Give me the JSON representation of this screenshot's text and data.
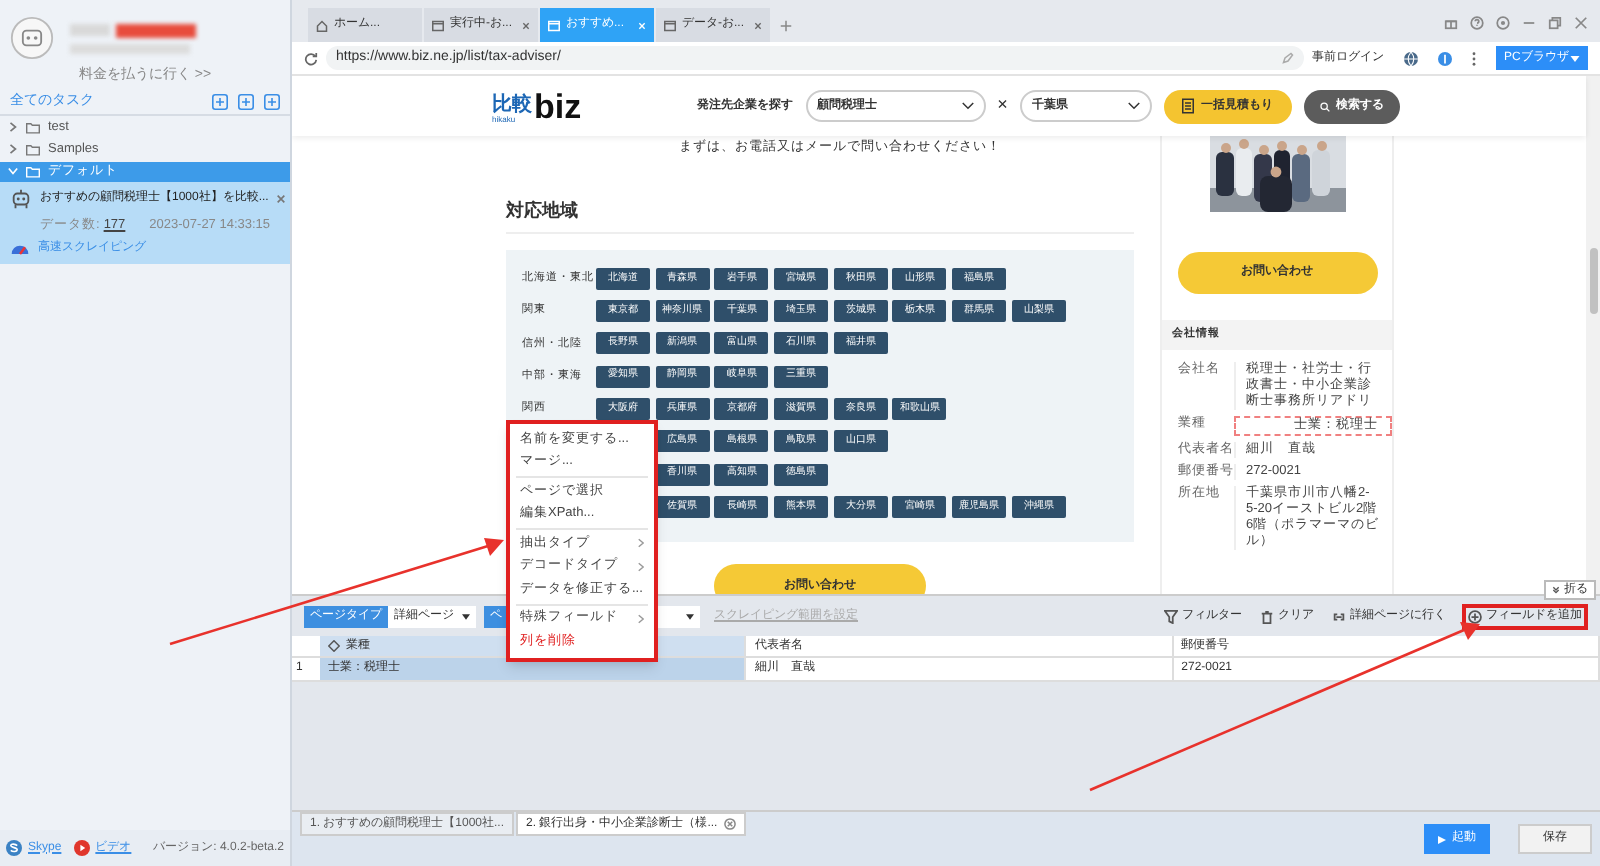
{
  "sidebar": {
    "pay_link": "料金を払うに行く >>",
    "all_tasks": "全てのタスク",
    "tree": [
      {
        "label": "test",
        "expanded": false,
        "selected": false
      },
      {
        "label": "Samples",
        "expanded": false,
        "selected": false
      },
      {
        "label": "デフォルト",
        "expanded": true,
        "selected": true,
        "children": [
          {
            "title": "おすすめの顧問税理士【1000社】を比較...",
            "count_label": "データ数:",
            "count": "177",
            "time": "2023-07-27 14:33:15",
            "mode": "高速スクレイピング"
          }
        ]
      }
    ],
    "footer": {
      "skype": "Skype",
      "video": "ビデオ",
      "version": "バージョン: 4.0.2-beta.2"
    }
  },
  "browser": {
    "tabs": [
      {
        "label": "ホーム...",
        "kind": "home",
        "selected": false
      },
      {
        "label": "実行中-お...",
        "kind": "page",
        "selected": false
      },
      {
        "label": "おすすめ...",
        "kind": "page",
        "selected": true
      },
      {
        "label": "データ-お...",
        "kind": "page",
        "selected": false
      }
    ],
    "url": "https://www.biz.ne.jp/list/tax-adviser/",
    "login": "事前ログイン",
    "pc_browser": "PCブラウザ"
  },
  "site": {
    "logo_kanji": "比較",
    "logo_roman": "hikaku",
    "logo_biz": "biz",
    "search_label": "発注先企業を探す",
    "industry": "顧問税理士",
    "times": "×",
    "prefecture": "千葉県",
    "estimate": "一括見積もり",
    "search": "検索する",
    "intro": "まずは、お電話又はメールで問い合わせください！",
    "region_heading": "対応地域",
    "regions": [
      {
        "label": "北海道・東北",
        "covered": false,
        "prefectures": [
          "北海道",
          "青森県",
          "岩手県",
          "宮城県",
          "秋田県",
          "山形県",
          "福島県"
        ]
      },
      {
        "label": "関東",
        "covered": false,
        "prefectures": [
          "東京都",
          "神奈川県",
          "千葉県",
          "埼玉県",
          "茨城県",
          "栃木県",
          "群馬県",
          "山梨県"
        ]
      },
      {
        "label": "信州・北陸",
        "covered": false,
        "prefectures": [
          "長野県",
          "新潟県",
          "富山県",
          "石川県",
          "福井県"
        ]
      },
      {
        "label": "中部・東海",
        "covered": false,
        "prefectures": [
          "愛知県",
          "静岡県",
          "岐阜県",
          "三重県"
        ]
      },
      {
        "label": "関西",
        "covered": false,
        "prefectures": [
          "大阪府",
          "兵庫県",
          "京都府",
          "滋賀県",
          "奈良県",
          "和歌山県"
        ]
      },
      {
        "covered": true,
        "prefectures": [
          "広島県",
          "島根県",
          "鳥取県",
          "山口県"
        ]
      },
      {
        "covered": true,
        "prefectures": [
          "香川県",
          "高知県",
          "徳島県"
        ]
      },
      {
        "covered": true,
        "prefectures": [
          "佐賀県",
          "長崎県",
          "熊本県",
          "大分県",
          "宮崎県",
          "鹿児島県",
          "沖縄県"
        ]
      }
    ],
    "contact": "お問い合わせ",
    "card": {
      "contact": "お問い合わせ",
      "info_title": "会社情報",
      "rows": [
        {
          "label": "会社名",
          "value": "税理士・社労士・行政書士・中小企業診断士事務所リアドリ",
          "highlighted": false
        },
        {
          "label": "業種",
          "value": "士業：税理士",
          "highlighted": true
        },
        {
          "label": "代表者名",
          "value": "細川　直哉",
          "highlighted": false
        },
        {
          "label": "郵便番号",
          "value": "272-0021",
          "highlighted": false
        },
        {
          "label": "所在地",
          "value": "千葉県市川市八幡2-5-20イーストビル2階6階（ポラマーマのビル）",
          "highlighted": false
        }
      ]
    }
  },
  "context_menu": {
    "highlighted": true,
    "items": [
      {
        "kind": "item",
        "label": "名前を変更する..."
      },
      {
        "kind": "item",
        "label": "マージ..."
      },
      {
        "kind": "divider"
      },
      {
        "kind": "item",
        "label": "ページで選択"
      },
      {
        "kind": "item",
        "label": "編集XPath..."
      },
      {
        "kind": "divider"
      },
      {
        "kind": "submenu",
        "label": "抽出タイプ"
      },
      {
        "kind": "submenu",
        "label": "デコードタイプ"
      },
      {
        "kind": "item",
        "label": "データを修正する..."
      },
      {
        "kind": "divider"
      },
      {
        "kind": "submenu",
        "label": "特殊フィールド"
      },
      {
        "kind": "danger",
        "label": "列を削除"
      }
    ]
  },
  "panel": {
    "collapse": "折る",
    "page_type_label": "ページタイプ",
    "page_type_value": "詳細ページ",
    "second_label": "ペ",
    "range_link": "スクレイピング範囲を設定",
    "actions": [
      {
        "kind": "filter",
        "label": "フィルター",
        "highlighted": false
      },
      {
        "kind": "clear",
        "label": "クリア",
        "highlighted": false
      },
      {
        "kind": "link",
        "label": "詳細ページに行く",
        "highlighted": false
      },
      {
        "kind": "add",
        "label": "フィールドを追加",
        "highlighted": true
      }
    ],
    "table": {
      "columns": [
        "業種",
        "代表者名",
        "郵便番号"
      ],
      "rows": [
        {
          "index": "1",
          "cells": [
            "士業：税理士",
            "細川　直哉",
            "272-0021"
          ]
        }
      ]
    }
  },
  "bottom": {
    "task_tabs": [
      {
        "label": "1. おすすめの顧問税理士【1000社...",
        "selected": false
      },
      {
        "label": "2. 銀行出身・中小企業診断士（様...",
        "selected": true
      }
    ],
    "run": "起動",
    "save": "保存"
  }
}
